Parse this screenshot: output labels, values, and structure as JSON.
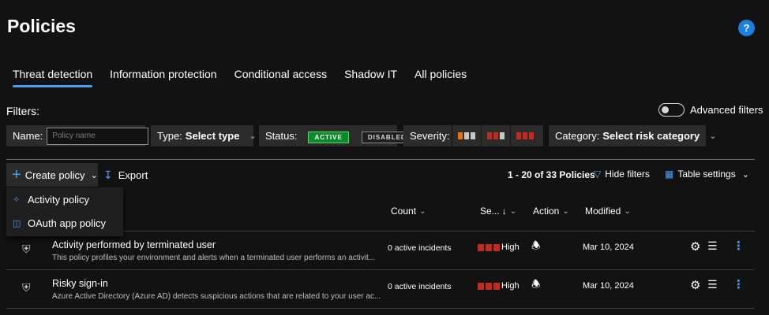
{
  "page": {
    "title": "Policies",
    "help": "?"
  },
  "tabs": [
    {
      "label": "Threat detection",
      "active": true
    },
    {
      "label": "Information protection"
    },
    {
      "label": "Conditional access"
    },
    {
      "label": "Shadow IT"
    },
    {
      "label": "All policies"
    }
  ],
  "filters": {
    "label": "Filters:",
    "advanced_label": "Advanced filters",
    "name": {
      "label": "Name:",
      "placeholder": "Policy name"
    },
    "type": {
      "label": "Type:",
      "value": "Select type"
    },
    "status": {
      "label": "Status:",
      "active": "ACTIVE",
      "disabled": "DISABLED"
    },
    "severity": {
      "label": "Severity:"
    },
    "category": {
      "label": "Category:",
      "value": "Select risk category"
    }
  },
  "toolbar": {
    "create": "Create policy",
    "export": "Export",
    "count": "1 - 20 of 33 Policies",
    "hide_filters": "Hide filters",
    "table_settings": "Table settings"
  },
  "create_menu": [
    {
      "label": "Activity policy",
      "icon": "activity-icon"
    },
    {
      "label": "OAuth app policy",
      "icon": "app-icon"
    }
  ],
  "columns": {
    "count": "Count",
    "severity": "Se...",
    "action": "Action",
    "modified": "Modified"
  },
  "rows": [
    {
      "name": "Activity performed by terminated user",
      "description": "This policy profiles your environment and alerts when a terminated user performs an activit...",
      "incidents": "0 active incidents",
      "severity": "High",
      "modified": "Mar 10, 2024"
    },
    {
      "name": "Risky sign-in",
      "description": "Azure Active Directory (Azure AD) detects suspicious actions that are related to your user ac...",
      "incidents": "0 active incidents",
      "severity": "High",
      "modified": "Mar 10, 2024"
    }
  ],
  "colors": {
    "accent": "#479ef5",
    "active": "#0d8a2b",
    "high": "#c42b1c",
    "medium": "#e8720c"
  }
}
